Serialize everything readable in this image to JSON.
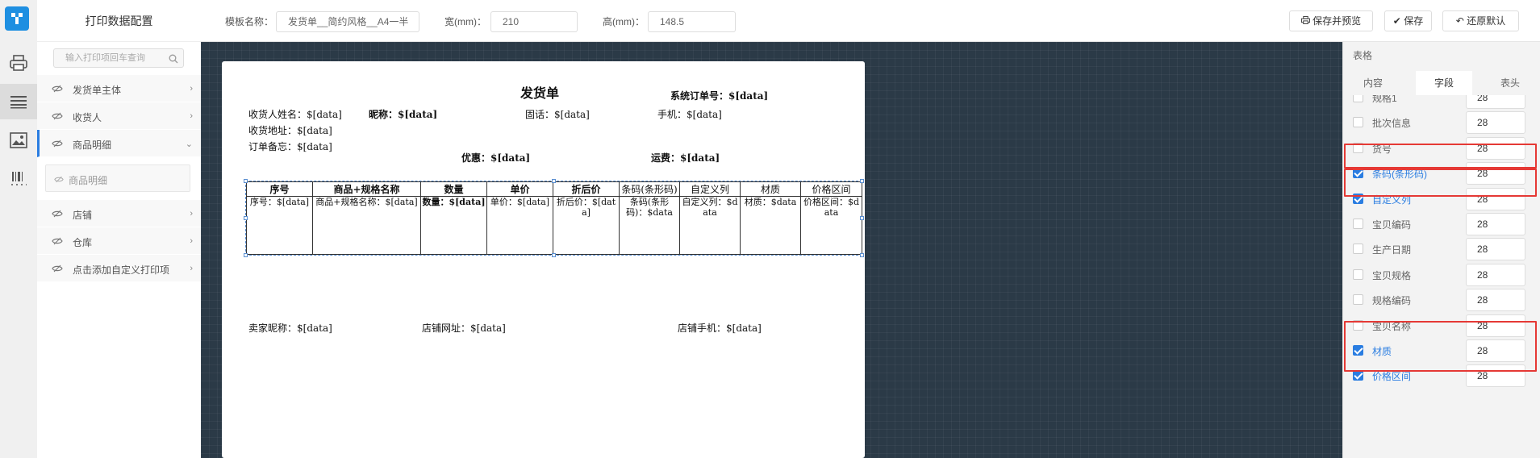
{
  "app": {
    "title": "打印数据配置"
  },
  "search": {
    "placeholder": "输入打印项回车查询"
  },
  "menu": [
    {
      "label": "发货单主体"
    },
    {
      "label": "收货人"
    },
    {
      "label": "商品明细"
    },
    {
      "label": "店铺"
    },
    {
      "label": "仓库"
    },
    {
      "label": "点击添加自定义打印项"
    }
  ],
  "submenu": {
    "label": "商品明细"
  },
  "toolbar": {
    "template_name_label": "模板名称：",
    "template_name_value": "发货单__简约风格__A4一半",
    "width_label": "宽(mm)：",
    "width_value": "210",
    "height_label": "高(mm)：",
    "height_value": "148.5",
    "save_preview_label": "保存并预览",
    "save_label": "保存",
    "restore_label": "还原默认"
  },
  "paper": {
    "title": "发货单",
    "order_no": "系统订单号：$[data]",
    "receiver_name": "收货人姓名：$[data]",
    "nickname": "昵称：$[data]",
    "phone": "固话：$[data]",
    "mobile": "手机：$[data]",
    "address": "收货地址：$[data]",
    "remark": "订单备忘：$[data]",
    "discount": "优惠：$[data]",
    "shipping": "运费：$[data]",
    "seller_nick": "卖家昵称：$[data]",
    "shop_url": "店铺网址：$[data]",
    "shop_mobile": "店铺手机：$[data]",
    "table": {
      "headers": [
        "序号",
        "商品+规格名称",
        "数量",
        "单价",
        "折后价",
        "条码(条形码)",
        "自定义列",
        "材质",
        "价格区间"
      ],
      "cells": [
        "序号：$[data]",
        "商品+规格名称：$[data]",
        "数量：$[data]",
        "单价：$[data]",
        "折后价：$[data]",
        "条码(条形码)：$data",
        "自定义列：$data",
        "材质：$data",
        "价格区间：$data"
      ]
    }
  },
  "right": {
    "header": "表格",
    "tabs": [
      "内容",
      "字段",
      "表头"
    ],
    "fields": [
      {
        "name": "规格1",
        "checked": false,
        "value": "28"
      },
      {
        "name": "批次信息",
        "checked": false,
        "value": "28"
      },
      {
        "name": "货号",
        "checked": false,
        "value": "28"
      },
      {
        "name": "条码(条形码)",
        "checked": true,
        "value": "28"
      },
      {
        "name": "自定义列",
        "checked": true,
        "value": "28"
      },
      {
        "name": "宝贝编码",
        "checked": false,
        "value": "28"
      },
      {
        "name": "生产日期",
        "checked": false,
        "value": "28"
      },
      {
        "name": "宝贝规格",
        "checked": false,
        "value": "28"
      },
      {
        "name": "规格编码",
        "checked": false,
        "value": "28"
      },
      {
        "name": "宝贝名称",
        "checked": false,
        "value": "28"
      },
      {
        "name": "材质",
        "checked": true,
        "value": "28"
      },
      {
        "name": "价格区间",
        "checked": true,
        "value": "28"
      }
    ]
  },
  "colors": {
    "accent": "#2a7de1",
    "highlight": "#e53935",
    "canvas": "#2b3a47"
  }
}
